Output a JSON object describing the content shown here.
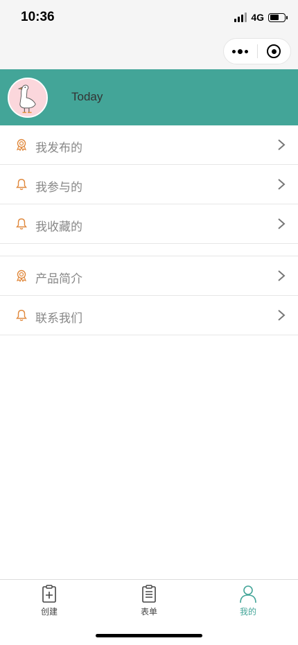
{
  "status": {
    "time": "10:36",
    "network": "4G"
  },
  "profile": {
    "name": "Today"
  },
  "menu_group1": [
    {
      "label": "我发布的",
      "icon": "badge-icon"
    },
    {
      "label": "我参与的",
      "icon": "bell-icon"
    },
    {
      "label": "我收藏的",
      "icon": "bell-icon"
    }
  ],
  "menu_group2": [
    {
      "label": "产品简介",
      "icon": "badge-icon"
    },
    {
      "label": "联系我们",
      "icon": "bell-icon"
    }
  ],
  "tabs": [
    {
      "label": "创建",
      "icon": "clipboard-add-icon"
    },
    {
      "label": "表单",
      "icon": "clipboard-list-icon"
    },
    {
      "label": "我的",
      "icon": "user-icon",
      "active": true
    }
  ],
  "colors": {
    "accent": "#43a598",
    "icon_orange": "#e0883c"
  }
}
